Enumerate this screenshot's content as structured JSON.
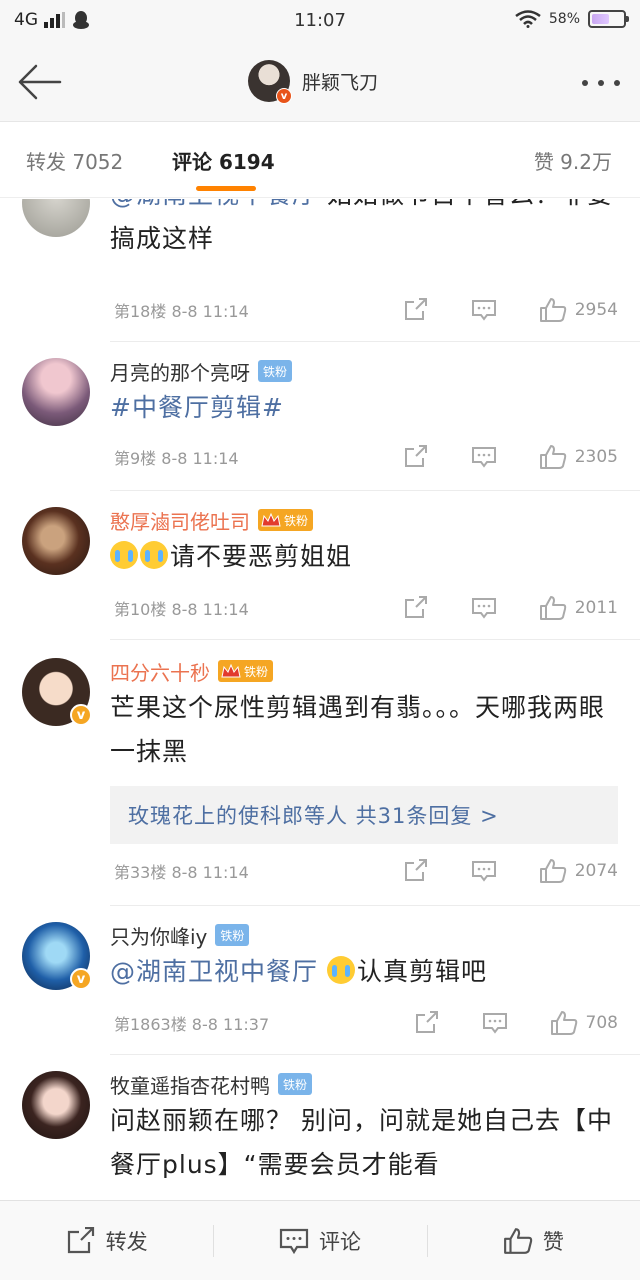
{
  "status_bar": {
    "network": "4G",
    "time": "11:07",
    "battery": "58%"
  },
  "header": {
    "account_name": "胖颖飞刀"
  },
  "tabs": {
    "repost": "转发 7052",
    "comment": "评论 6194",
    "like": "赞 9.2万"
  },
  "comments": [
    {
      "name": "",
      "text_link": "@湖南卫视中餐厅",
      "text": " 姑姑做节目不香么？非要搞成这样",
      "floor": "第18楼 8-8 11:14",
      "likes": "2954"
    },
    {
      "name": "月亮的那个亮呀",
      "badge": "铁粉",
      "text_link": "#中餐厅剪辑#",
      "text": "",
      "floor": "第9楼 8-8 11:14",
      "likes": "2305"
    },
    {
      "name": "憨厚滷司佬吐司",
      "badge": "铁粉",
      "text": "请不要恶剪姐姐",
      "floor": "第10楼 8-8 11:14",
      "likes": "2011"
    },
    {
      "name": "四分六十秒",
      "badge": "铁粉",
      "text": "芒果这个尿性剪辑遇到有翡。。。天哪我两眼一抹黑",
      "reply_summary": "玫瑰花上的使科郎等人  共31条回复  >",
      "floor": "第33楼 8-8 11:14",
      "likes": "2074"
    },
    {
      "name": "只为你峰iy",
      "badge": "铁粉",
      "text_link": "@湖南卫视中餐厅",
      "text": "认真剪辑吧",
      "floor": "第1863楼 8-8 11:37",
      "likes": "708"
    },
    {
      "name": "牧童遥指杏花村鸭",
      "badge": "铁粉",
      "text": "问赵丽颖在哪？ 别问，问就是她自己去【中餐厅plus】“需要会员才能看"
    }
  ],
  "bottom_bar": {
    "repost": "转发",
    "comment": "评论",
    "like": "赞"
  },
  "colors": {
    "accent": "#ff8200",
    "link": "#4e6fa2",
    "fan_badge": "#7ab4ea",
    "gold_badge": "#f5a623"
  }
}
